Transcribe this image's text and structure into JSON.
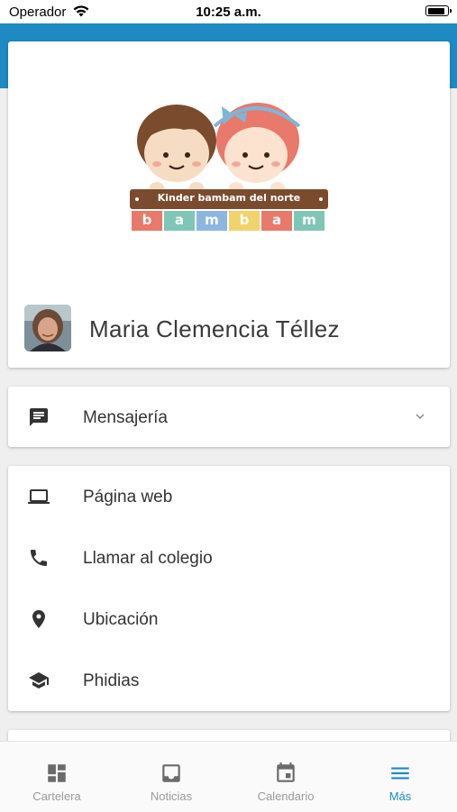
{
  "status_bar": {
    "carrier": "Operador",
    "time": "10:25 a.m."
  },
  "profile": {
    "logo_title": "Kinder bambam del norte",
    "logo_letters": [
      "b",
      "a",
      "m",
      "b",
      "a",
      "m"
    ],
    "name": "Maria Clemencia Téllez"
  },
  "messaging": {
    "label": "Mensajería",
    "icon": "message-icon"
  },
  "links": [
    {
      "label": "Página web",
      "icon": "laptop-icon"
    },
    {
      "label": "Llamar al colegio",
      "icon": "phone-icon"
    },
    {
      "label": "Ubicación",
      "icon": "location-pin-icon"
    },
    {
      "label": "Phidias",
      "icon": "school-cap-icon"
    }
  ],
  "tabbar": {
    "tabs": [
      {
        "label": "Cartelera",
        "icon": "dashboard-icon"
      },
      {
        "label": "Noticias",
        "icon": "inbox-icon"
      },
      {
        "label": "Calendario",
        "icon": "calendar-icon"
      },
      {
        "label": "Más",
        "icon": "menu-icon"
      }
    ],
    "active_index": 3
  },
  "colors": {
    "header": "#1f89c3",
    "accent": "#1f89c3",
    "tab_inactive": "#9a9a9a"
  }
}
